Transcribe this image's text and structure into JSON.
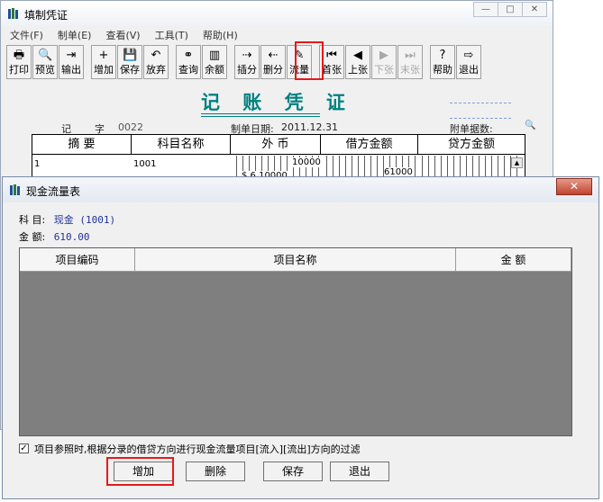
{
  "main": {
    "title": "填制凭证",
    "caption_buttons": [
      "—",
      "□",
      "✕"
    ],
    "menu": [
      "文件(F)",
      "制单(E)",
      "查看(V)",
      "工具(T)",
      "帮助(H)"
    ],
    "toolbar": [
      {
        "label": "打印",
        "icon": "printer-icon",
        "glyph": "🖶",
        "enabled": true
      },
      {
        "label": "预览",
        "icon": "preview-icon",
        "glyph": "🔍",
        "enabled": true
      },
      {
        "label": "输出",
        "icon": "export-icon",
        "glyph": "⇥",
        "enabled": true
      },
      {
        "label": "增加",
        "icon": "add-icon",
        "glyph": "+",
        "enabled": true
      },
      {
        "label": "保存",
        "icon": "save-icon",
        "glyph": "💾",
        "enabled": true
      },
      {
        "label": "放弃",
        "icon": "undo-icon",
        "glyph": "↶",
        "enabled": true
      },
      {
        "label": "查询",
        "icon": "binoculars-icon",
        "glyph": "⚭",
        "enabled": true
      },
      {
        "label": "余额",
        "icon": "bar-chart-icon",
        "glyph": "▥",
        "enabled": true
      },
      {
        "label": "插分",
        "icon": "insert-row-icon",
        "glyph": "⇢",
        "enabled": true
      },
      {
        "label": "删分",
        "icon": "delete-row-icon",
        "glyph": "⇠",
        "enabled": true
      },
      {
        "label": "流量",
        "icon": "pencil-icon",
        "glyph": "✎",
        "enabled": true
      },
      {
        "label": "首张",
        "icon": "first-icon",
        "glyph": "⏮",
        "enabled": true
      },
      {
        "label": "上张",
        "icon": "prev-icon",
        "glyph": "◀",
        "enabled": true
      },
      {
        "label": "下张",
        "icon": "next-icon",
        "glyph": "▶",
        "enabled": false
      },
      {
        "label": "末张",
        "icon": "last-icon",
        "glyph": "⏭",
        "enabled": false
      },
      {
        "label": "帮助",
        "icon": "help-icon",
        "glyph": "?",
        "enabled": true
      },
      {
        "label": "退出",
        "icon": "exit-icon",
        "glyph": "⇨",
        "enabled": true
      }
    ],
    "voucher": {
      "title": "记 账 凭 证",
      "type_label": "记",
      "char_label": "字",
      "number": "0022",
      "date_label": "制单日期:",
      "date": "2011.12.31",
      "attach_label": "附单据数:",
      "columns": [
        "摘 要",
        "科目名称",
        "外 币",
        "借方金额",
        "贷方金额"
      ],
      "row": {
        "summary": "1",
        "account": "1001",
        "fx_amount": "10000",
        "fx_rate": "$ 6.10000",
        "debit": "61000"
      }
    }
  },
  "dialog": {
    "title": "现金流量表",
    "close_glyph": "✕",
    "subject_label": "科 目:",
    "subject_value": "现金 (1001)",
    "amount_label": "金 额:",
    "amount_value": "610.00",
    "columns": [
      "项目编码",
      "项目名称",
      "金 额"
    ],
    "checkbox_checked": true,
    "checkbox_mark": "✓",
    "checkbox_label": "项目参照时,根据分录的借贷方向进行现金流量项目[流入][流出]方向的过滤",
    "buttons": {
      "add": "增加",
      "delete": "删除",
      "save": "保存",
      "exit": "退出"
    }
  }
}
